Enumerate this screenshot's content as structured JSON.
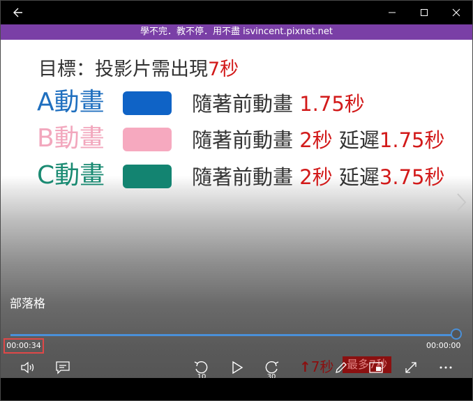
{
  "window": {
    "banner_text": "學不完．教不停．用不盡 isvincent.pixnet.net"
  },
  "slide": {
    "title_prefix": "目標：投影片需出現",
    "title_highlight": "7秒",
    "rows": [
      {
        "label": "A動畫",
        "label_color": "#1f6fbf",
        "swatch_color": "#0f63c6",
        "desc_text": "隨著前動畫",
        "desc_highlight": "1.75秒",
        "delay_text": "",
        "delay_highlight": ""
      },
      {
        "label": "B動畫",
        "label_color": "#f2a7bd",
        "swatch_color": "#f6a9bf",
        "desc_text": "隨著前動畫",
        "desc_highlight": "2秒",
        "delay_text": "延遲",
        "delay_highlight": "1.75秒"
      },
      {
        "label": "C動畫",
        "label_color": "#1a8a72",
        "swatch_color": "#138471",
        "desc_text": "隨著前動畫",
        "desc_highlight": "2秒",
        "delay_text": "延遲",
        "delay_highlight": "3.75秒"
      }
    ]
  },
  "player": {
    "caption": "部落格",
    "current_time": "00:00:34",
    "total_time": "00:00:00",
    "skip_back_seconds": "10",
    "skip_forward_seconds": "30",
    "overlay_note": "7秒",
    "overlay_badge": "最多7秒",
    "accent_color": "#4a90d9"
  }
}
